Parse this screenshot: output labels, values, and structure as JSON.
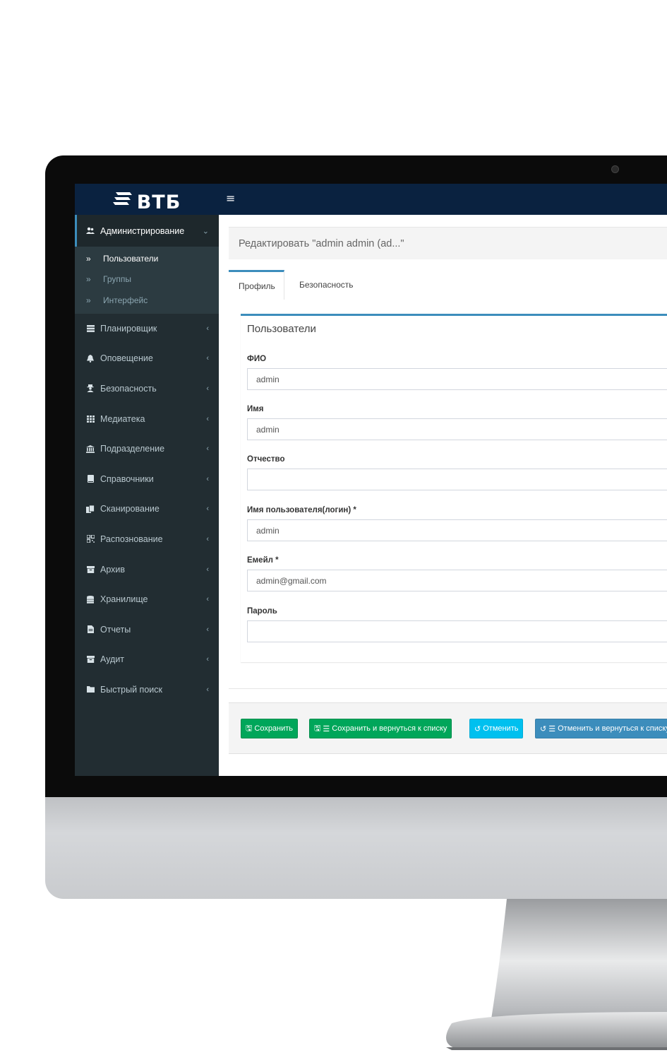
{
  "brand": {
    "name": "ВТБ"
  },
  "topbar": {
    "menu_toggle": "≡"
  },
  "sidebar": {
    "active_group": {
      "label": "Администрирование",
      "icon": "users-icon"
    },
    "subitems": [
      {
        "label": "Пользователи",
        "chevron": "»",
        "active": true
      },
      {
        "label": "Группы",
        "chevron": "»",
        "active": false
      },
      {
        "label": "Интерфейс",
        "chevron": "»",
        "active": false
      }
    ],
    "items": [
      {
        "label": "Планировщик",
        "icon": "tasks-icon"
      },
      {
        "label": "Оповещение",
        "icon": "bell-icon"
      },
      {
        "label": "Безопасность",
        "icon": "user-secret-icon"
      },
      {
        "label": "Медиатека",
        "icon": "grid-icon"
      },
      {
        "label": "Подразделение",
        "icon": "bank-icon"
      },
      {
        "label": "Справочники",
        "icon": "book-icon"
      },
      {
        "label": "Сканирование",
        "icon": "copy-icon"
      },
      {
        "label": "Распознование",
        "icon": "qrcode-icon"
      },
      {
        "label": "Архив",
        "icon": "archive-icon"
      },
      {
        "label": "Хранилище",
        "icon": "database-icon"
      },
      {
        "label": "Отчеты",
        "icon": "file-text-icon"
      },
      {
        "label": "Аудит",
        "icon": "archive-icon"
      },
      {
        "label": "Быстрый поиск",
        "icon": "folder-icon"
      }
    ]
  },
  "page": {
    "title": "Редактировать \"admin admin (ad...\"",
    "tabs": [
      {
        "label": "Профиль",
        "active": true
      },
      {
        "label": "Безопасность",
        "active": false
      }
    ]
  },
  "form": {
    "title": "Пользователи",
    "fields": [
      {
        "label": "ФИО",
        "value": "admin"
      },
      {
        "label": "Имя",
        "value": "admin"
      },
      {
        "label": "Отчество",
        "value": ""
      },
      {
        "label": "Имя пользователя(логин) *",
        "value": "admin"
      },
      {
        "label": "Емейл *",
        "value": "admin@gmail.com"
      },
      {
        "label": "Пароль",
        "value": ""
      }
    ]
  },
  "actions": {
    "save": "Сохранить",
    "save_and_list": "Сохранить и вернуться к списку",
    "cancel": "Отменить",
    "cancel_and_list": "Отменить и вернуться к списку"
  },
  "colors": {
    "topbar": "#0a2240",
    "sidebar": "#222d32",
    "accent": "#3c8dbc",
    "success": "#00a65a",
    "info": "#00c0ef"
  }
}
